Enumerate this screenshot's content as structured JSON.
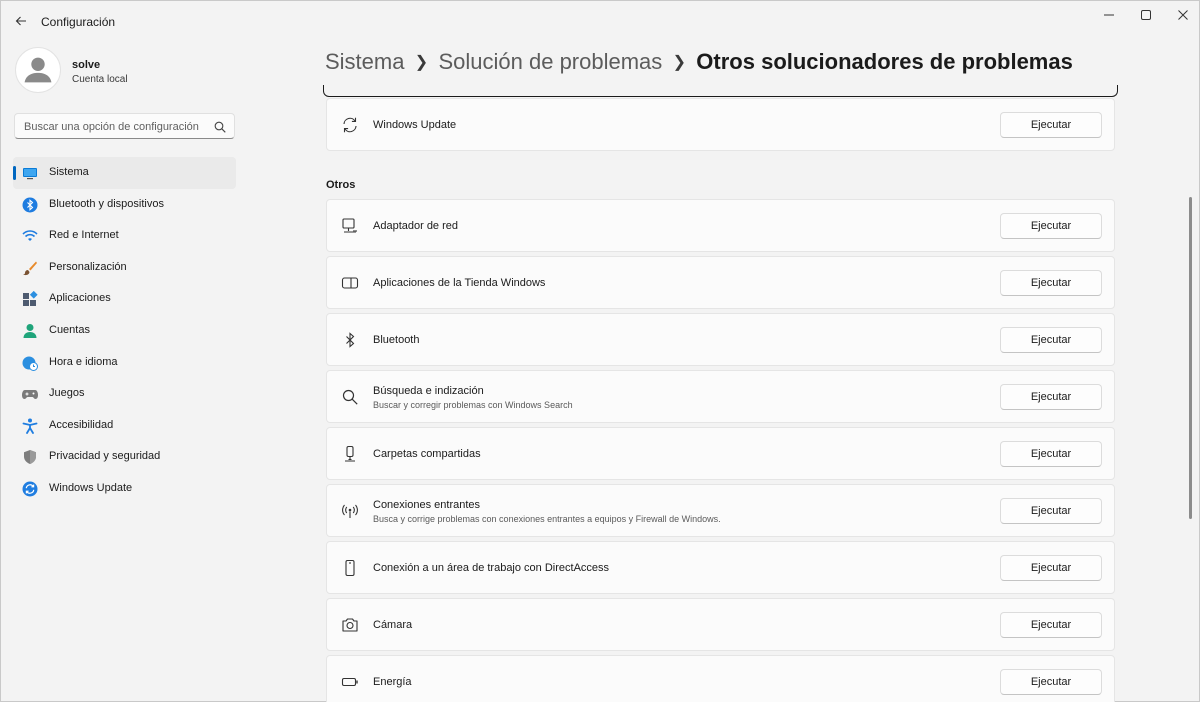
{
  "app": {
    "title": "Configuración"
  },
  "profile": {
    "name": "solve",
    "account": "Cuenta local"
  },
  "search": {
    "placeholder": "Buscar una opción de configuración"
  },
  "sidebar": {
    "items": [
      {
        "label": "Sistema",
        "icon": "monitor-icon",
        "active": true
      },
      {
        "label": "Bluetooth y dispositivos",
        "icon": "bluetooth-icon"
      },
      {
        "label": "Red e Internet",
        "icon": "wifi-icon"
      },
      {
        "label": "Personalización",
        "icon": "brush-icon"
      },
      {
        "label": "Aplicaciones",
        "icon": "apps-icon"
      },
      {
        "label": "Cuentas",
        "icon": "person-icon"
      },
      {
        "label": "Hora e idioma",
        "icon": "globe-clock-icon"
      },
      {
        "label": "Juegos",
        "icon": "gamepad-icon"
      },
      {
        "label": "Accesibilidad",
        "icon": "accessibility-icon"
      },
      {
        "label": "Privacidad y seguridad",
        "icon": "shield-icon"
      },
      {
        "label": "Windows Update",
        "icon": "update-icon"
      }
    ]
  },
  "breadcrumb": {
    "items": [
      "Sistema",
      "Solución de problemas"
    ],
    "current": "Otros solucionadores de problemas"
  },
  "top_card": {
    "title": "Windows Update",
    "button": "Ejecutar",
    "icon": "refresh-icon"
  },
  "section": {
    "label": "Otros"
  },
  "troubleshooters": [
    {
      "title": "Adaptador de red",
      "desc": "",
      "button": "Ejecutar",
      "icon": "network-adapter-icon"
    },
    {
      "title": "Aplicaciones de la Tienda Windows",
      "desc": "",
      "button": "Ejecutar",
      "icon": "store-app-icon"
    },
    {
      "title": "Bluetooth",
      "desc": "",
      "button": "Ejecutar",
      "icon": "bluetooth-icon"
    },
    {
      "title": "Búsqueda e indización",
      "desc": "Buscar y corregir problemas con Windows Search",
      "button": "Ejecutar",
      "icon": "search-icon"
    },
    {
      "title": "Carpetas compartidas",
      "desc": "",
      "button": "Ejecutar",
      "icon": "shared-folder-icon"
    },
    {
      "title": "Conexiones entrantes",
      "desc": "Busca y corrige problemas con conexiones entrantes a equipos y Firewall de Windows.",
      "button": "Ejecutar",
      "icon": "antenna-icon"
    },
    {
      "title": "Conexión a un área de trabajo con DirectAccess",
      "desc": "",
      "button": "Ejecutar",
      "icon": "phone-icon"
    },
    {
      "title": "Cámara",
      "desc": "",
      "button": "Ejecutar",
      "icon": "camera-icon"
    },
    {
      "title": "Energía",
      "desc": "",
      "button": "Ejecutar",
      "icon": "battery-icon"
    }
  ],
  "colors": {
    "accent": "#0067c0",
    "background": "#f3f3f3",
    "card": "#fbfbfb"
  }
}
